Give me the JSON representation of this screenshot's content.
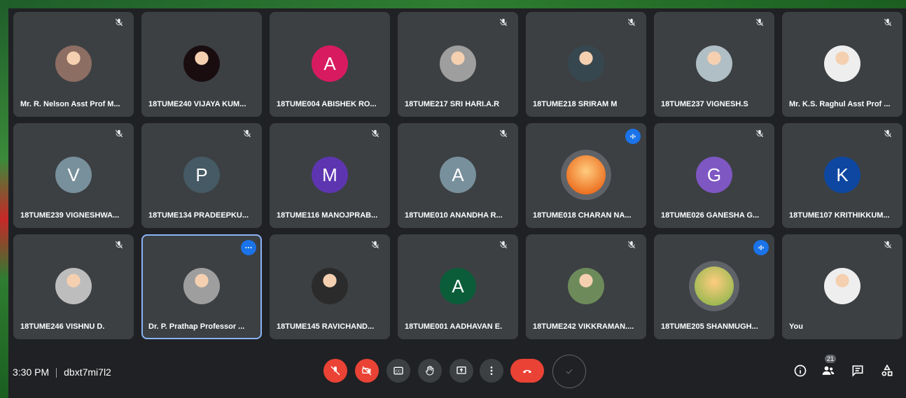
{
  "meeting": {
    "time": "3:30 PM",
    "code": "dbxt7mi7l2",
    "participant_count": "21"
  },
  "participants": [
    {
      "name": "Mr. R. Nelson Asst Prof M...",
      "initial": "",
      "avatar_color": "#8d6e63",
      "photo": true,
      "muted": true
    },
    {
      "name": "18TUME240 VIJAYA KUM...",
      "initial": "",
      "avatar_color": "#1a0d10",
      "photo": true,
      "muted": false
    },
    {
      "name": "18TUME004 ABISHEK RO...",
      "initial": "A",
      "avatar_color": "#d81b60",
      "photo": false,
      "muted": false
    },
    {
      "name": "18TUME217 SRI HARI.A.R",
      "initial": "",
      "avatar_color": "#9e9e9e",
      "photo": true,
      "muted": true
    },
    {
      "name": "18TUME218 SRIRAM M",
      "initial": "",
      "avatar_color": "#37474f",
      "photo": true,
      "muted": true
    },
    {
      "name": "18TUME237 VIGNESH.S",
      "initial": "",
      "avatar_color": "#b0bec5",
      "photo": true,
      "muted": true
    },
    {
      "name": "Mr. K.S. Raghul Asst Prof ...",
      "initial": "",
      "avatar_color": "#eeeeee",
      "photo": true,
      "muted": true
    },
    {
      "name": "18TUME239 VIGNESHWA...",
      "initial": "V",
      "avatar_color": "#78909c",
      "photo": false,
      "muted": true
    },
    {
      "name": "18TUME134 PRADEEPKU...",
      "initial": "P",
      "avatar_color": "#455a64",
      "photo": false,
      "muted": true
    },
    {
      "name": "18TUME116 MANOJPRAB...",
      "initial": "M",
      "avatar_color": "#5e35b1",
      "photo": false,
      "muted": true
    },
    {
      "name": "18TUME010 ANANDHA R...",
      "initial": "A",
      "avatar_color": "#78909c",
      "photo": false,
      "muted": true
    },
    {
      "name": "18TUME018 CHARAN NA...",
      "initial": "",
      "avatar_color": "#e65100",
      "photo": true,
      "muted": false,
      "speaking": true
    },
    {
      "name": "18TUME026 GANESHA G...",
      "initial": "G",
      "avatar_color": "#7e57c2",
      "photo": false,
      "muted": true
    },
    {
      "name": "18TUME107 KRITHIKKUM...",
      "initial": "K",
      "avatar_color": "#0d47a1",
      "photo": false,
      "muted": true
    },
    {
      "name": "18TUME246 VISHNU D.",
      "initial": "",
      "avatar_color": "#bdbdbd",
      "photo": true,
      "muted": true
    },
    {
      "name": "Dr. P. Prathap Professor ...",
      "initial": "",
      "avatar_color": "#9e9e9e",
      "photo": true,
      "muted": false,
      "pinned": true
    },
    {
      "name": "18TUME145 RAVICHAND...",
      "initial": "",
      "avatar_color": "#2b2b2b",
      "photo": true,
      "muted": true
    },
    {
      "name": "18TUME001 AADHAVAN E.",
      "initial": "A",
      "avatar_color": "#0b5d3a",
      "photo": false,
      "muted": true
    },
    {
      "name": "18TUME242 VIKKRAMAN....",
      "initial": "",
      "avatar_color": "#6d8b5a",
      "photo": true,
      "muted": true
    },
    {
      "name": "18TUME205 SHANMUGH...",
      "initial": "",
      "avatar_color": "#7cb342",
      "photo": true,
      "muted": false,
      "speaking": true
    },
    {
      "name": "You",
      "initial": "",
      "avatar_color": "#eeeeee",
      "photo": true,
      "muted": true
    }
  ],
  "controls": {
    "mic": "mic-off-icon",
    "camera": "camera-off-icon",
    "captions": "captions-icon",
    "hand": "raise-hand-icon",
    "present": "present-screen-icon",
    "more": "more-options-icon",
    "leave": "hang-up-icon"
  },
  "colors": {
    "accent": "#1a73e8",
    "danger": "#ea4335",
    "tile": "#3c4043",
    "background": "#202124"
  }
}
